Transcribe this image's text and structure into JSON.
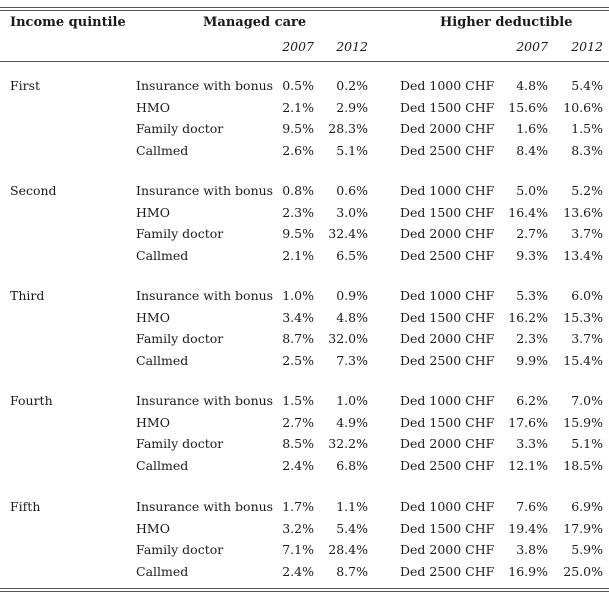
{
  "table": {
    "headers": {
      "income_quintile": "Income quintile",
      "managed_care": "Managed care",
      "higher_deductible": "Higher deductible",
      "mc_year_1": "2007",
      "mc_year_2": "2012",
      "hd_year_1": "2007",
      "hd_year_2": "2012"
    },
    "groups": [
      {
        "quintile": "First",
        "rows": [
          {
            "mc_plan": "Insurance with bonus",
            "mc_2007": "0.5%",
            "mc_2012": "0.2%",
            "hd_plan": "Ded 1000 CHF",
            "hd_2007": "4.8%",
            "hd_2012": "5.4%"
          },
          {
            "mc_plan": "HMO",
            "mc_2007": "2.1%",
            "mc_2012": "2.9%",
            "hd_plan": "Ded 1500 CHF",
            "hd_2007": "15.6%",
            "hd_2012": "10.6%"
          },
          {
            "mc_plan": "Family doctor",
            "mc_2007": "9.5%",
            "mc_2012": "28.3%",
            "hd_plan": "Ded 2000 CHF",
            "hd_2007": "1.6%",
            "hd_2012": "1.5%"
          },
          {
            "mc_plan": "Callmed",
            "mc_2007": "2.6%",
            "mc_2012": "5.1%",
            "hd_plan": "Ded 2500 CHF",
            "hd_2007": "8.4%",
            "hd_2012": "8.3%"
          }
        ]
      },
      {
        "quintile": "Second",
        "rows": [
          {
            "mc_plan": "Insurance with bonus",
            "mc_2007": "0.8%",
            "mc_2012": "0.6%",
            "hd_plan": "Ded 1000 CHF",
            "hd_2007": "5.0%",
            "hd_2012": "5.2%"
          },
          {
            "mc_plan": "HMO",
            "mc_2007": "2.3%",
            "mc_2012": "3.0%",
            "hd_plan": "Ded 1500 CHF",
            "hd_2007": "16.4%",
            "hd_2012": "13.6%"
          },
          {
            "mc_plan": "Family doctor",
            "mc_2007": "9.5%",
            "mc_2012": "32.4%",
            "hd_plan": "Ded 2000 CHF",
            "hd_2007": "2.7%",
            "hd_2012": "3.7%"
          },
          {
            "mc_plan": "Callmed",
            "mc_2007": "2.1%",
            "mc_2012": "6.5%",
            "hd_plan": "Ded 2500 CHF",
            "hd_2007": "9.3%",
            "hd_2012": "13.4%"
          }
        ]
      },
      {
        "quintile": "Third",
        "rows": [
          {
            "mc_plan": "Insurance with bonus",
            "mc_2007": "1.0%",
            "mc_2012": "0.9%",
            "hd_plan": "Ded 1000 CHF",
            "hd_2007": "5.3%",
            "hd_2012": "6.0%"
          },
          {
            "mc_plan": "HMO",
            "mc_2007": "3.4%",
            "mc_2012": "4.8%",
            "hd_plan": "Ded 1500 CHF",
            "hd_2007": "16.2%",
            "hd_2012": "15.3%"
          },
          {
            "mc_plan": "Family doctor",
            "mc_2007": "8.7%",
            "mc_2012": "32.0%",
            "hd_plan": "Ded 2000 CHF",
            "hd_2007": "2.3%",
            "hd_2012": "3.7%"
          },
          {
            "mc_plan": "Callmed",
            "mc_2007": "2.5%",
            "mc_2012": "7.3%",
            "hd_plan": "Ded 2500 CHF",
            "hd_2007": "9.9%",
            "hd_2012": "15.4%"
          }
        ]
      },
      {
        "quintile": "Fourth",
        "rows": [
          {
            "mc_plan": "Insurance with bonus",
            "mc_2007": "1.5%",
            "mc_2012": "1.0%",
            "hd_plan": "Ded 1000 CHF",
            "hd_2007": "6.2%",
            "hd_2012": "7.0%"
          },
          {
            "mc_plan": "HMO",
            "mc_2007": "2.7%",
            "mc_2012": "4.9%",
            "hd_plan": "Ded 1500 CHF",
            "hd_2007": "17.6%",
            "hd_2012": "15.9%"
          },
          {
            "mc_plan": "Family doctor",
            "mc_2007": "8.5%",
            "mc_2012": "32.2%",
            "hd_plan": "Ded 2000 CHF",
            "hd_2007": "3.3%",
            "hd_2012": "5.1%"
          },
          {
            "mc_plan": "Callmed",
            "mc_2007": "2.4%",
            "mc_2012": "6.8%",
            "hd_plan": "Ded 2500 CHF",
            "hd_2007": "12.1%",
            "hd_2012": "18.5%"
          }
        ]
      },
      {
        "quintile": "Fifth",
        "rows": [
          {
            "mc_plan": "Insurance with bonus",
            "mc_2007": "1.7%",
            "mc_2012": "1.1%",
            "hd_plan": "Ded 1000 CHF",
            "hd_2007": "7.6%",
            "hd_2012": "6.9%"
          },
          {
            "mc_plan": "HMO",
            "mc_2007": "3.2%",
            "mc_2012": "5.4%",
            "hd_plan": "Ded 1500 CHF",
            "hd_2007": "19.4%",
            "hd_2012": "17.9%"
          },
          {
            "mc_plan": "Family doctor",
            "mc_2007": "7.1%",
            "mc_2012": "28.4%",
            "hd_plan": "Ded 2000 CHF",
            "hd_2007": "3.8%",
            "hd_2012": "5.9%"
          },
          {
            "mc_plan": "Callmed",
            "mc_2007": "2.4%",
            "mc_2012": "8.7%",
            "hd_plan": "Ded 2500 CHF",
            "hd_2007": "16.9%",
            "hd_2012": "25.0%"
          }
        ]
      }
    ]
  }
}
